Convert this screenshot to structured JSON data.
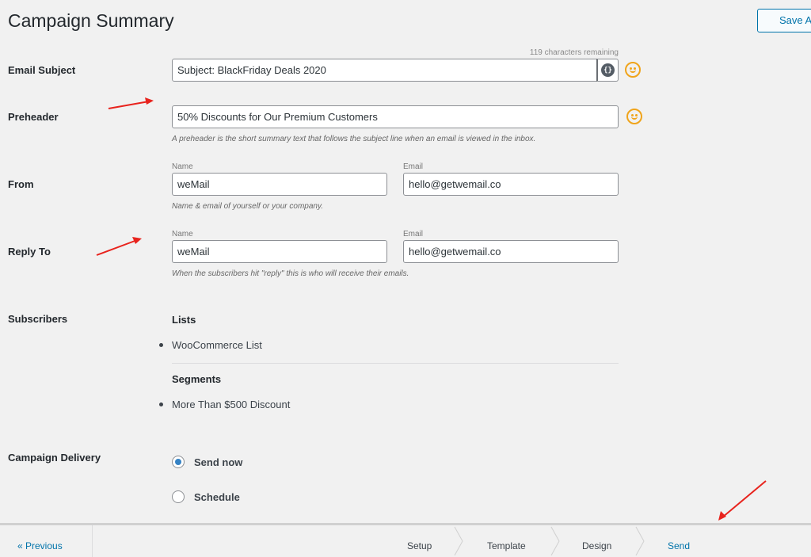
{
  "page": {
    "title": "Campaign Summary",
    "save_label": "Save As"
  },
  "email_subject": {
    "label": "Email Subject",
    "chars_remaining": "119 characters remaining",
    "value": "Subject: BlackFriday Deals 2020",
    "shortcode_glyph": "{}"
  },
  "preheader": {
    "label": "Preheader",
    "value": "50% Discounts for Our Premium Customers",
    "help": "A preheader is the short summary text that follows the subject line when an email is viewed in the inbox."
  },
  "from": {
    "label": "From",
    "name_label": "Name",
    "email_label": "Email",
    "name_value": "weMail",
    "email_value": "hello@getwemail.co",
    "help": "Name & email of yourself or your company."
  },
  "reply_to": {
    "label": "Reply To",
    "name_label": "Name",
    "email_label": "Email",
    "name_value": "weMail",
    "email_value": "hello@getwemail.co",
    "help": "When the subscribers hit \"reply\" this is who will receive their emails."
  },
  "subscribers": {
    "label": "Subscribers",
    "lists_heading": "Lists",
    "lists": [
      "WooCommerce List"
    ],
    "segments_heading": "Segments",
    "segments": [
      "More Than $500 Discount"
    ]
  },
  "delivery": {
    "label": "Campaign Delivery",
    "options": [
      {
        "label": "Send now",
        "selected": true
      },
      {
        "label": "Schedule",
        "selected": false
      }
    ]
  },
  "footer": {
    "previous_label": "« Previous",
    "steps": [
      {
        "label": "Setup",
        "active": false
      },
      {
        "label": "Template",
        "active": false
      },
      {
        "label": "Design",
        "active": false
      },
      {
        "label": "Send",
        "active": true
      }
    ]
  },
  "colors": {
    "accent": "#0073aa",
    "emoji": "#f0a41b",
    "annotation_arrow": "#e8231d"
  },
  "icons": {
    "shortcode": "shortcode-icon",
    "emoji": "smiley-icon",
    "arrow": "annotation-arrow-icon"
  }
}
